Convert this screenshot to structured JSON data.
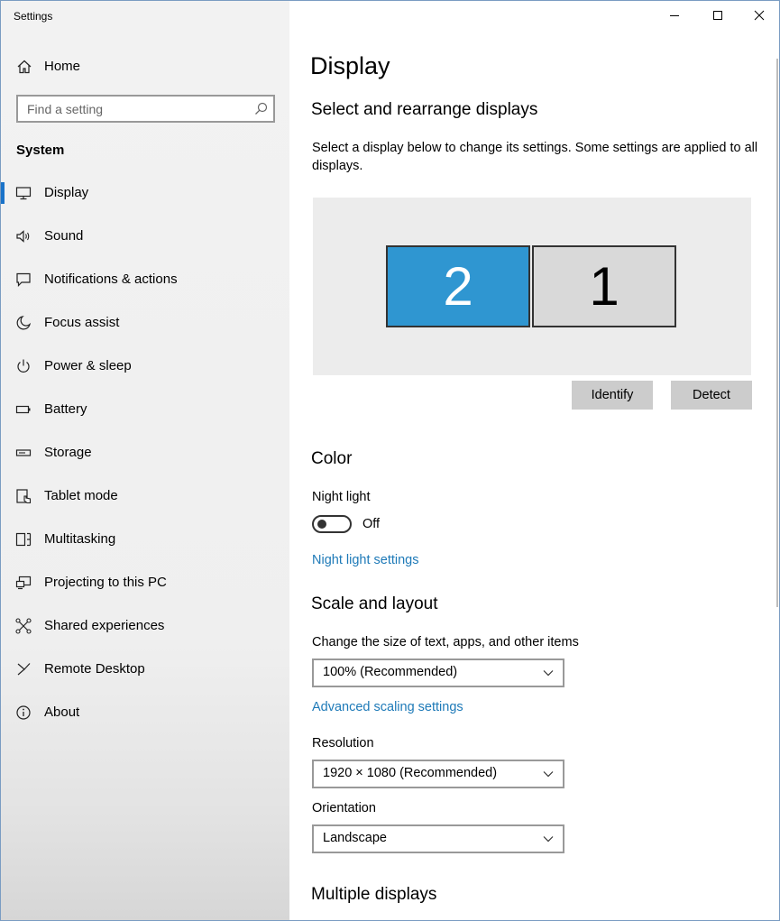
{
  "window": {
    "title": "Settings"
  },
  "sidebar": {
    "home_label": "Home",
    "search_placeholder": "Find a setting",
    "section_label": "System",
    "items": [
      {
        "label": "Display",
        "icon": "monitor-icon",
        "active": true
      },
      {
        "label": "Sound",
        "icon": "speaker-icon"
      },
      {
        "label": "Notifications & actions",
        "icon": "notification-icon"
      },
      {
        "label": "Focus assist",
        "icon": "moon-icon"
      },
      {
        "label": "Power & sleep",
        "icon": "power-icon"
      },
      {
        "label": "Battery",
        "icon": "battery-icon"
      },
      {
        "label": "Storage",
        "icon": "storage-icon"
      },
      {
        "label": "Tablet mode",
        "icon": "tablet-icon"
      },
      {
        "label": "Multitasking",
        "icon": "multitasking-icon"
      },
      {
        "label": "Projecting to this PC",
        "icon": "projector-icon"
      },
      {
        "label": "Shared experiences",
        "icon": "shared-icon"
      },
      {
        "label": "Remote Desktop",
        "icon": "remote-icon"
      },
      {
        "label": "About",
        "icon": "info-icon"
      }
    ]
  },
  "main": {
    "title": "Display",
    "arrange": {
      "heading": "Select and rearrange displays",
      "description": "Select a display below to change its settings. Some settings are applied to all displays.",
      "monitor_left": "2",
      "monitor_right": "1",
      "identify_label": "Identify",
      "detect_label": "Detect"
    },
    "color": {
      "heading": "Color",
      "night_light_label": "Night light",
      "night_light_state": "Off",
      "night_light_link": "Night light settings"
    },
    "scale": {
      "heading": "Scale and layout",
      "size_label": "Change the size of text, apps, and other items",
      "size_value": "100% (Recommended)",
      "advanced_link": "Advanced scaling settings",
      "resolution_label": "Resolution",
      "resolution_value": "1920 × 1080 (Recommended)",
      "orientation_label": "Orientation",
      "orientation_value": "Landscape"
    },
    "multiple": {
      "heading": "Multiple displays"
    }
  },
  "colors": {
    "accent": "#2f96d1",
    "link": "#1e7ab8",
    "active_indicator": "#1a73c9"
  }
}
